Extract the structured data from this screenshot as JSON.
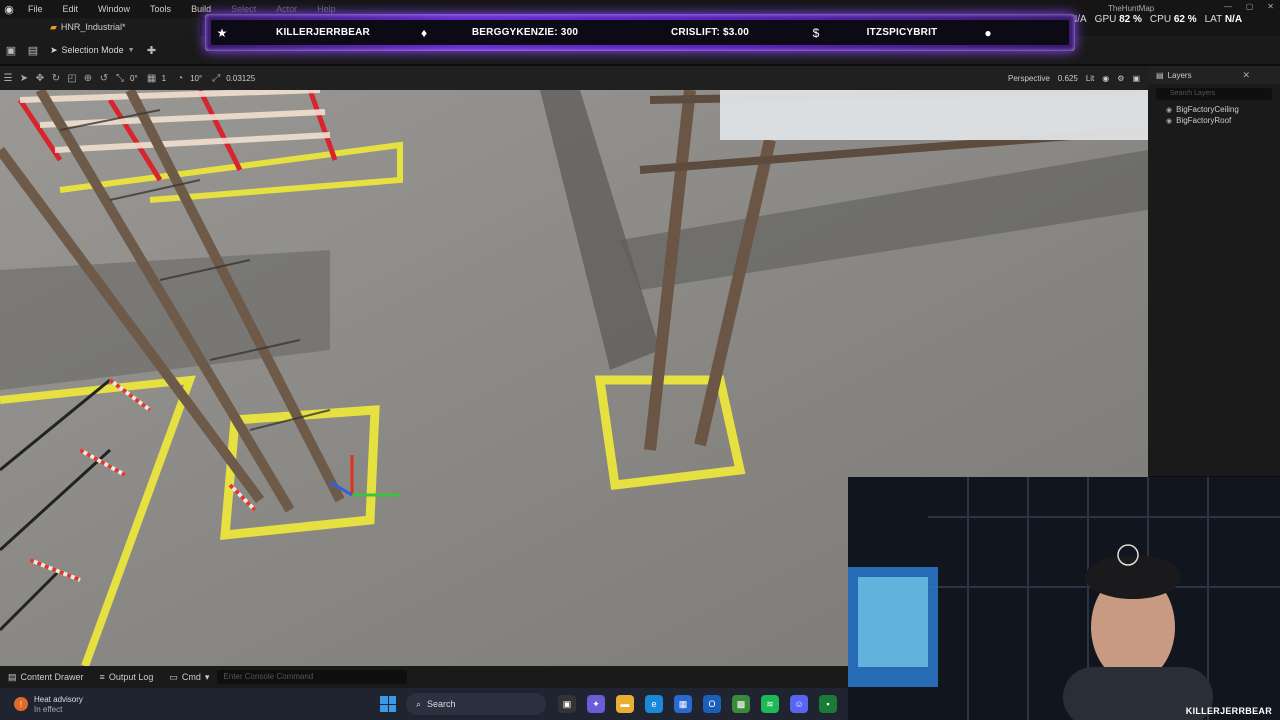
{
  "menubar": {
    "items": [
      "File",
      "Edit",
      "Window",
      "Tools",
      "Build",
      "Select",
      "Actor",
      "Help"
    ]
  },
  "project": {
    "tab_label": "HNR_Industrial*"
  },
  "topright": {
    "map_name": "TheHuntMap",
    "na_left": "N/A",
    "gpu_label": "GPU",
    "gpu_value": "82 %",
    "cpu_label": "CPU",
    "cpu_value": "62 %",
    "lat_label": "LAT",
    "lat_value": "N/A"
  },
  "toolbar": {
    "mode_label": "Selection Mode"
  },
  "viewport_toolbar": {
    "rotation_snap": "0°",
    "scale_snap_count": "1",
    "angle_snap": "10°",
    "scale_value": "0.03125",
    "view_mode": "Perspective",
    "camera_speed": "0.625",
    "lighting": "Lit"
  },
  "layers": {
    "title": "Layers",
    "search_placeholder": "Search Layers",
    "items": [
      "BigFactoryCeiling",
      "BigFactoryRoof"
    ]
  },
  "statusbar": {
    "content_drawer": "Content Drawer",
    "output_log": "Output Log",
    "cmd": "Cmd",
    "cmd_placeholder": "Enter Console Command"
  },
  "taskbar": {
    "weather_title": "Heat advisory",
    "weather_sub": "In effect",
    "weather_badge": "!",
    "search": "Search"
  },
  "alert": {
    "user1": "KILLERJERRBEAR",
    "user2": "BERGGYKENZIE: 300",
    "user3": "CRISLIFT: $3.00",
    "user4": "ITZSPICYBRIT"
  },
  "webcam": {
    "name": "KILLERJERRBEAR"
  },
  "colors": {
    "accent_purple": "#6a2cd0",
    "taskbar": "#1f2430"
  }
}
